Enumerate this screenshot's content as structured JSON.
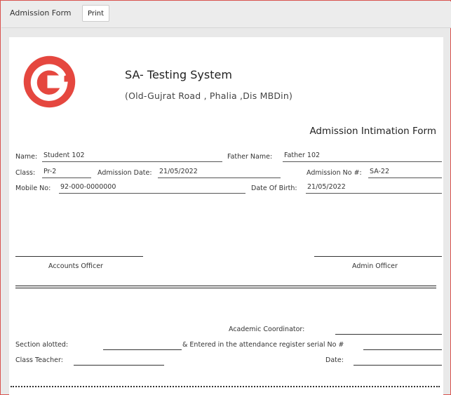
{
  "toolbar": {
    "title": "Admission Form",
    "print_label": "Print"
  },
  "header": {
    "logo_letter": "G",
    "logo_color": "#e5473f",
    "school_name": "SA- Testing System",
    "address": "(Old-Gujrat Road , Phalia ,Dis MBDin)",
    "form_title": "Admission Intimation Form"
  },
  "fields": {
    "name_label": "Name:",
    "name_value": "Student 102",
    "father_label": "Father Name:",
    "father_value": "Father 102",
    "class_label": "Class:",
    "class_value": "Pr-2",
    "admission_date_label": "Admission Date:",
    "admission_date_value": "21/05/2022",
    "admission_no_label": "Admission No #:",
    "admission_no_value": "SA-22",
    "mobile_label": "Mobile No:",
    "mobile_value": "92-000-0000000",
    "dob_label": "Date Of Birth:",
    "dob_value": "21/05/2022"
  },
  "signatures": {
    "accounts_officer": "Accounts Officer",
    "admin_officer": "Admin Officer"
  },
  "lower": {
    "academic_coordinator": "Academic Coordinator:",
    "section_alotted": "Section alotted:",
    "attendance_register": "& Entered in the attendance register serial No #",
    "class_teacher": "Class Teacher:",
    "date": "Date:"
  }
}
